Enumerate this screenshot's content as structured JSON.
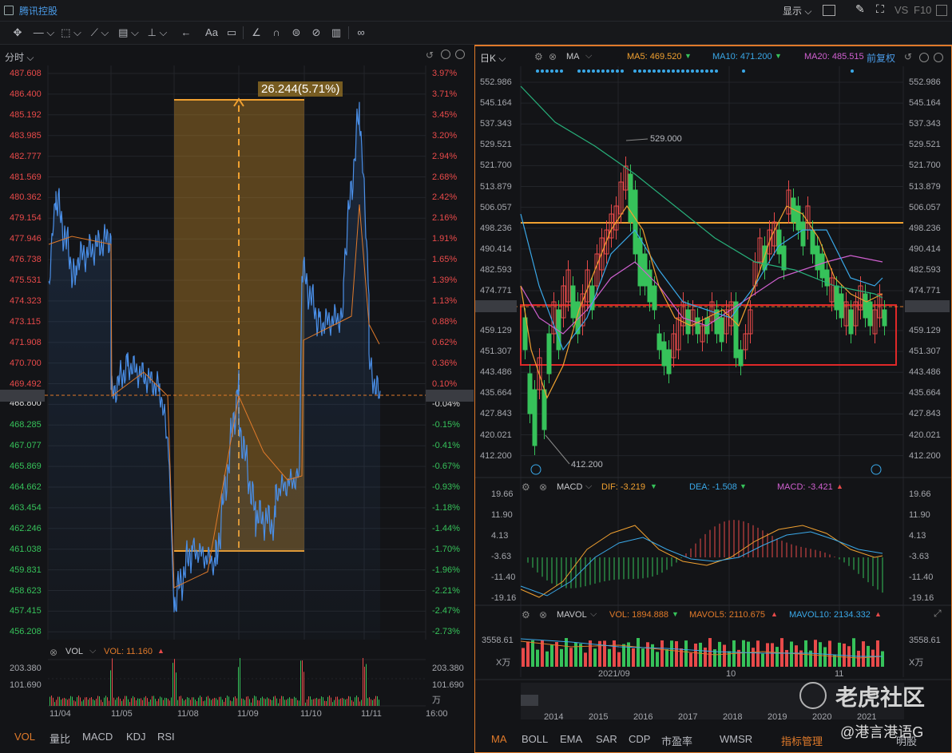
{
  "app": {
    "stock_name": "腾讯控股"
  },
  "topbar": {
    "display_label": "显示",
    "vs_label": "VS",
    "f10_label": "F10"
  },
  "toolbar": {
    "text_tool": "Aa"
  },
  "intraday": {
    "title": "分时",
    "price_axis": [
      "487.608",
      "486.400",
      "485.192",
      "483.985",
      "482.777",
      "481.569",
      "480.362",
      "479.154",
      "477.946",
      "476.738",
      "475.531",
      "474.323",
      "473.115",
      "471.908",
      "470.700",
      "469.492",
      "468.800",
      "468.285",
      "467.077",
      "465.869",
      "464.662",
      "463.454",
      "462.246",
      "461.038",
      "459.831",
      "458.623",
      "457.415",
      "456.208"
    ],
    "pct_axis": [
      "3.97%",
      "3.71%",
      "3.45%",
      "3.20%",
      "2.94%",
      "2.68%",
      "2.42%",
      "2.16%",
      "1.91%",
      "1.65%",
      "1.39%",
      "1.13%",
      "0.88%",
      "0.62%",
      "0.36%",
      "0.10%",
      "-0.04%",
      "-0.15%",
      "-0.41%",
      "-0.67%",
      "-0.93%",
      "-1.18%",
      "-1.44%",
      "-1.70%",
      "-1.96%",
      "-2.21%",
      "-2.47%",
      "-2.73%"
    ],
    "measure_label": "26.244(5.71%)",
    "vol_label": "VOL",
    "vol_value": "VOL: 11.160",
    "vol_axis": [
      "203.380",
      "101.690"
    ],
    "vol_axis_right": [
      "203.380",
      "101.690",
      "万"
    ],
    "dates": [
      "11/04",
      "11/05",
      "11/08",
      "11/09",
      "11/10",
      "11/11",
      "16:00"
    ],
    "tabs": [
      "VOL",
      "量比",
      "MACD",
      "KDJ",
      "RSI"
    ]
  },
  "daily": {
    "title": "日K",
    "indicator": "MA",
    "ma5": "MA5: 469.520",
    "ma10": "MA10: 471.200",
    "ma20": "MA20: 485.515",
    "adjust": "前复权",
    "price_axis": [
      "552.986",
      "545.164",
      "537.343",
      "529.521",
      "521.700",
      "513.879",
      "506.057",
      "498.236",
      "490.414",
      "482.593",
      "474.771",
      "468.800",
      "459.129",
      "451.307",
      "443.486",
      "435.664",
      "427.843",
      "420.021",
      "412.200"
    ],
    "high_label": "529.000",
    "low_label": "412.200",
    "macd_label": "MACD",
    "dif": "DIF: -3.219",
    "dea": "DEA: -1.508",
    "macd": "MACD: -3.421",
    "macd_axis": [
      "19.66",
      "11.90",
      "4.13",
      "-3.63",
      "-11.40",
      "-19.16"
    ],
    "mavol_label": "MAVOL",
    "vol": "VOL: 1894.888",
    "mavol5": "MAVOL5: 2110.675",
    "mavol10": "MAVOL10: 2134.332",
    "vol_axis": [
      "3558.61",
      "X万"
    ],
    "months": [
      "2021/09",
      "10",
      "11"
    ],
    "years": [
      "2014",
      "2015",
      "2016",
      "2017",
      "2018",
      "2019",
      "2020",
      "2021"
    ],
    "tabs": [
      "MA",
      "BOLL",
      "EMA",
      "SAR",
      "CDP",
      "市盈率",
      "WMSR",
      "指标管理",
      "明股"
    ]
  },
  "watermark": {
    "brand": "老虎社区",
    "handle": "@港言港语G"
  },
  "colors": {
    "up": "#e84a4a",
    "down": "#36c25a",
    "price_line": "#4a8fe8",
    "accent": "#e07a2a",
    "ma5": "#f0a030",
    "ma10": "#3aa8e8",
    "ma20": "#d060d0"
  }
}
